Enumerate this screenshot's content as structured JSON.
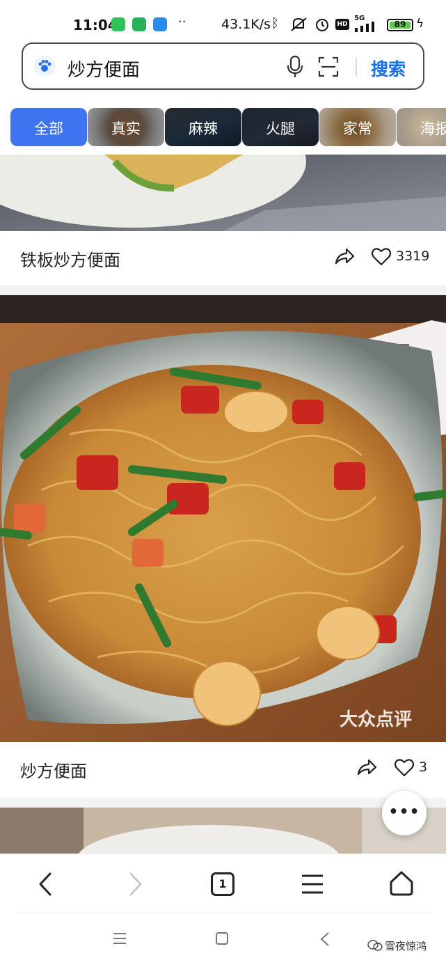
{
  "status_bar": {
    "time": "11:04",
    "net_speed": "43.1K/s",
    "hd_label": "HD",
    "network_label": "5G",
    "battery": "89"
  },
  "search": {
    "query": "炒方便面",
    "button_label": "搜索"
  },
  "chips": [
    {
      "label": "全部",
      "active": true
    },
    {
      "label": "真实",
      "active": false
    },
    {
      "label": "麻辣",
      "active": false
    },
    {
      "label": "火腿",
      "active": false
    },
    {
      "label": "家常",
      "active": false
    },
    {
      "label": "海报",
      "active": false
    }
  ],
  "cards": [
    {
      "title": "铁板炒方便面",
      "likes": "3319"
    },
    {
      "title": "炒方便面",
      "likes": "3"
    }
  ],
  "watermarks": {
    "photo": "大众点评",
    "account": "雪夜惊鸿"
  },
  "browser_bar": {
    "tab_count": "1"
  },
  "colors": {
    "accent": "#3e74f0",
    "search_button": "#1a6fe8"
  }
}
